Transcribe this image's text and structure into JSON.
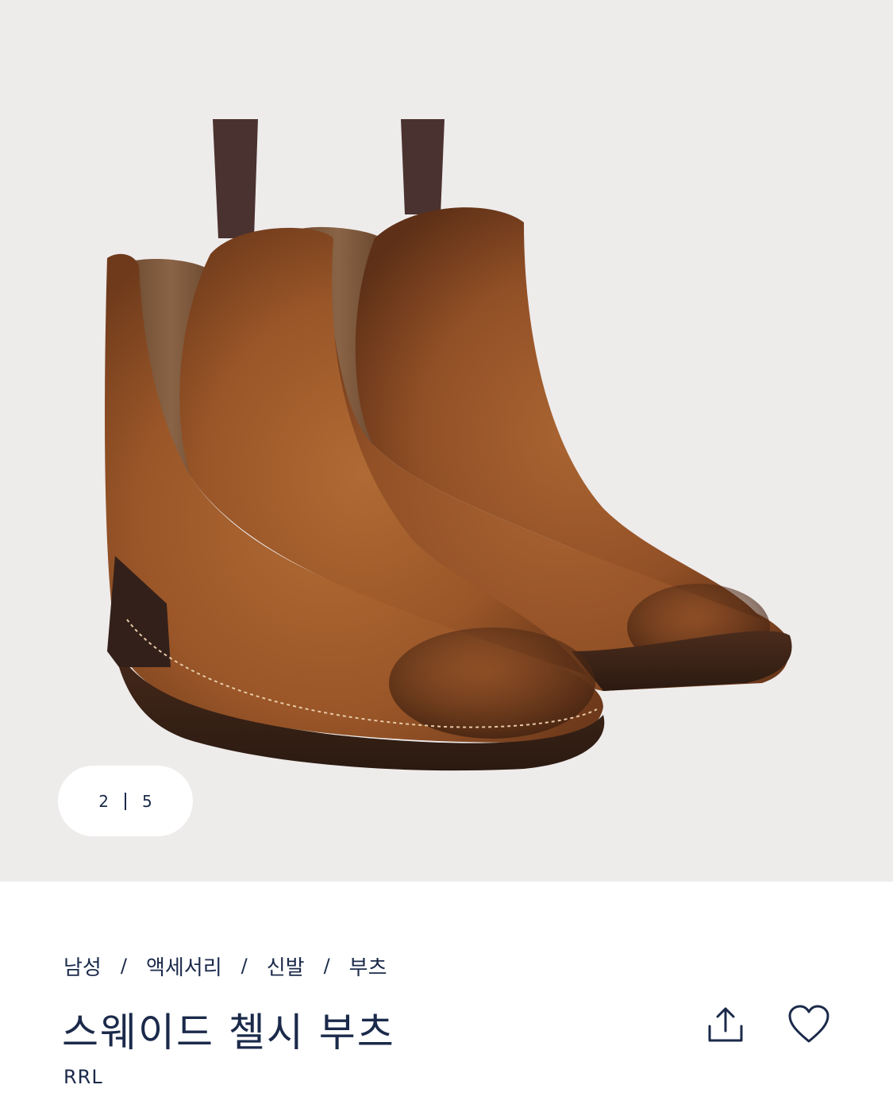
{
  "gallery": {
    "current_index": "2",
    "total": "5",
    "image_alt": "suede chelsea boots product photo",
    "background": "#eeebeb"
  },
  "breadcrumb": [
    "남성",
    "액세서리",
    "신발",
    "부츠"
  ],
  "product": {
    "title": "스웨이드 첼시 부츠",
    "brand": "RRL"
  },
  "actions": {
    "share_icon": "share-icon",
    "wishlist_icon": "heart-icon"
  },
  "colors": {
    "text": "#1b2a4a",
    "suede": "#9a5a2c",
    "sole": "#3a2318"
  }
}
